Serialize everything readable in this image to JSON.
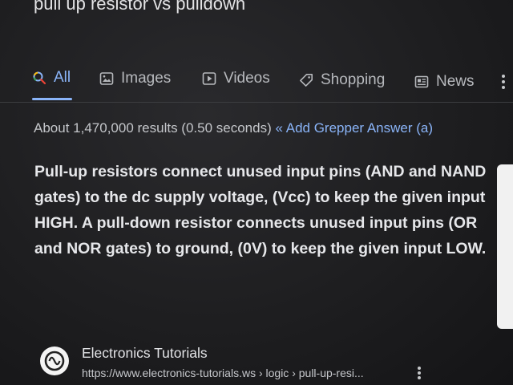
{
  "search": {
    "query": "pull up resistor vs pulldown"
  },
  "tabs": [
    {
      "label": "All",
      "icon": "search-icon",
      "active": true
    },
    {
      "label": "Images",
      "icon": "image-icon",
      "active": false
    },
    {
      "label": "Videos",
      "icon": "play-icon",
      "active": false
    },
    {
      "label": "Shopping",
      "icon": "tag-icon",
      "active": false
    },
    {
      "label": "News",
      "icon": "newspaper-icon",
      "active": false
    }
  ],
  "results_stats": {
    "text": "About 1,470,000 results (0.50 seconds)",
    "grepper_link": "« Add Grepper Answer (a)"
  },
  "featured_snippet": {
    "text": "Pull-up resistors connect unused input pins (AND and NAND gates) to the dc supply voltage, (Vcc) to keep the given input HIGH. A pull-down resistor connects unused input pins (OR and NOR gates) to ground, (0V) to keep the given input LOW."
  },
  "source": {
    "name": "Electronics Tutorials",
    "url": "https://www.electronics-tutorials.ws › logic › pull-up-resi..."
  },
  "colors": {
    "background": "#1e1e20",
    "accent": "#8ab4f8",
    "text": "#e8eaed"
  }
}
